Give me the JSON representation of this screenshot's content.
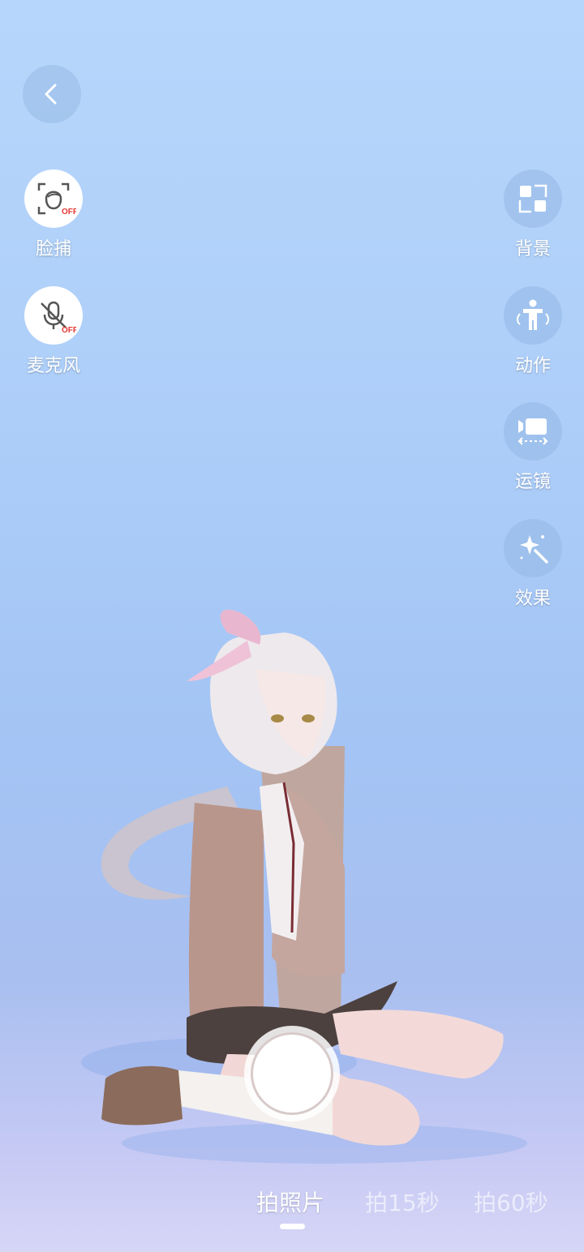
{
  "left_controls": [
    {
      "label": "脸捕",
      "icon": "face-capture-icon",
      "state": "OFF"
    },
    {
      "label": "麦克风",
      "icon": "microphone-muted-icon",
      "state": "OFF"
    }
  ],
  "right_controls": [
    {
      "label": "背景",
      "icon": "grid-icon"
    },
    {
      "label": "动作",
      "icon": "figure-icon"
    },
    {
      "label": "运镜",
      "icon": "camera-move-icon"
    },
    {
      "label": "效果",
      "icon": "magic-wand-icon"
    }
  ],
  "modes": [
    {
      "label": "拍照片",
      "active": true
    },
    {
      "label": "拍15秒",
      "active": false
    },
    {
      "label": "拍60秒",
      "active": false
    }
  ],
  "colors": {
    "off_badge": "#e53935",
    "background_top": "#b7d6fb",
    "background_bottom": "#d6d6f6"
  }
}
